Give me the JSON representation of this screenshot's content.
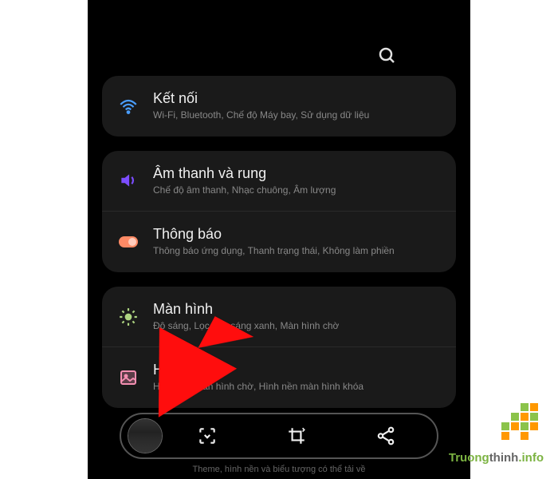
{
  "settings": {
    "connections": {
      "title": "Kết nối",
      "subtitle": "Wi-Fi, Bluetooth, Chế độ Máy bay, Sử dụng dữ liệu"
    },
    "sound": {
      "title": "Âm thanh và rung",
      "subtitle": "Chế độ âm thanh, Nhạc chuông, Âm lượng"
    },
    "notifications": {
      "title": "Thông báo",
      "subtitle": "Thông báo ứng dụng, Thanh trạng thái, Không làm phiền"
    },
    "display": {
      "title": "Màn hình",
      "subtitle": "Độ sáng, Lọc ánh sáng xanh, Màn hình chờ"
    },
    "wallpaper": {
      "title": "Hình nền",
      "subtitle": "Hình nền màn hình chờ, Hình nền màn hình khóa"
    }
  },
  "bottom_hint": "Theme, hình nền và biểu tượng có thể tải về",
  "watermark": {
    "part1": "Truong",
    "part2": "thinh",
    "part3": ".info"
  },
  "colors": {
    "wifi": "#4a9eff",
    "sound": "#7c4dff",
    "notification": "#ff8a65",
    "display": "#aed581",
    "wallpaper": "#f48fb1"
  }
}
